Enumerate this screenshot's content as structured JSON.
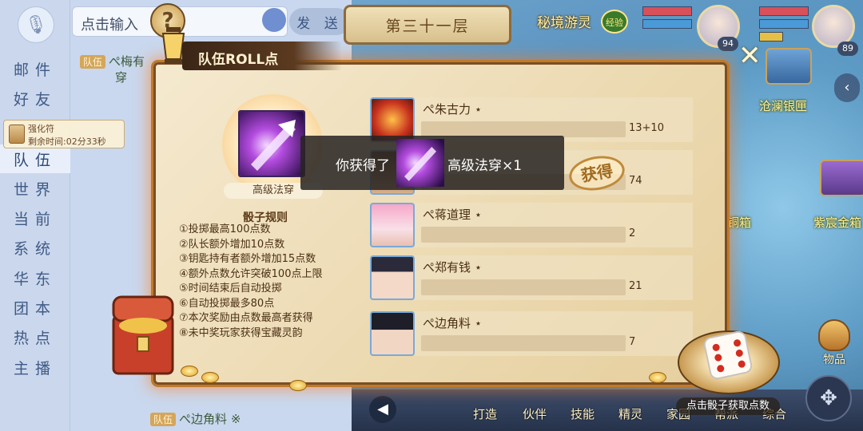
{
  "chat": {
    "input_placeholder": "点击输入",
    "send_label": "发 送",
    "tabs": [
      "邮件",
      "好友",
      "队伍",
      "世界",
      "当前",
      "系统",
      "华东",
      "团本",
      "热点",
      "主播"
    ],
    "active_tab": "队伍",
    "team_tag": "队伍",
    "messages": [
      {
        "sender": "ぺ梅有",
        "text": "穿"
      },
      {
        "sender": "ぺ边角料",
        "text": "※"
      }
    ],
    "buff": {
      "name": "强化符",
      "remaining_label": "剩余时间:",
      "remaining": "02分33秒"
    }
  },
  "stage": {
    "label": "第三十一层"
  },
  "hud": {
    "map_title": "秘境游灵",
    "exp_badge": "经验",
    "party": [
      {
        "level": "94"
      },
      {
        "level": "89"
      }
    ],
    "map_labels": [
      "沧澜银匣",
      "紫宸金箱",
      "铜箱"
    ],
    "collapse_icon": "‹"
  },
  "roll_panel": {
    "title": "队伍ROLL点",
    "reward": {
      "name": "高级法穿"
    },
    "rules_title": "骰子规则",
    "rules": [
      "①投掷最高100点数",
      "②队长额外增加10点数",
      "③钥匙持有者额外增加15点数",
      "④额外点数允许突破100点上限",
      "⑤时间结束后自动投掷",
      "⑥自动投掷最多80点",
      "⑦本次奖励由点数最高者获得",
      "⑧未中奖玩家获得宝藏灵韵"
    ],
    "players": [
      {
        "name": "ぺ朱古力 ⋆",
        "score": "13+10",
        "progress": 0.23
      },
      {
        "name": "ぺ",
        "score": "74",
        "progress": 0.74,
        "won": true
      },
      {
        "name": "ぺ蒋道理 ⋆",
        "score": "2",
        "progress": 0.02
      },
      {
        "name": "ぺ郑有钱 ⋆",
        "score": "21",
        "progress": 0.21
      },
      {
        "name": "ぺ边角料 ⋆",
        "score": "7",
        "progress": 0.07
      }
    ],
    "won_stamp": "获得"
  },
  "toast": {
    "prefix": "你获得了",
    "suffix": "高级法穿×1"
  },
  "dice": {
    "label": "点击骰子获取点数"
  },
  "bottom_bar": {
    "items": [
      "打造",
      "伙伴",
      "技能",
      "精灵",
      "家园",
      "帮派",
      "综合"
    ]
  },
  "items_button": {
    "label": "物品"
  },
  "colors": {
    "accent": "#c07a2a",
    "panel": "#f1e3c2",
    "dice_pip": "#d32c1e"
  }
}
